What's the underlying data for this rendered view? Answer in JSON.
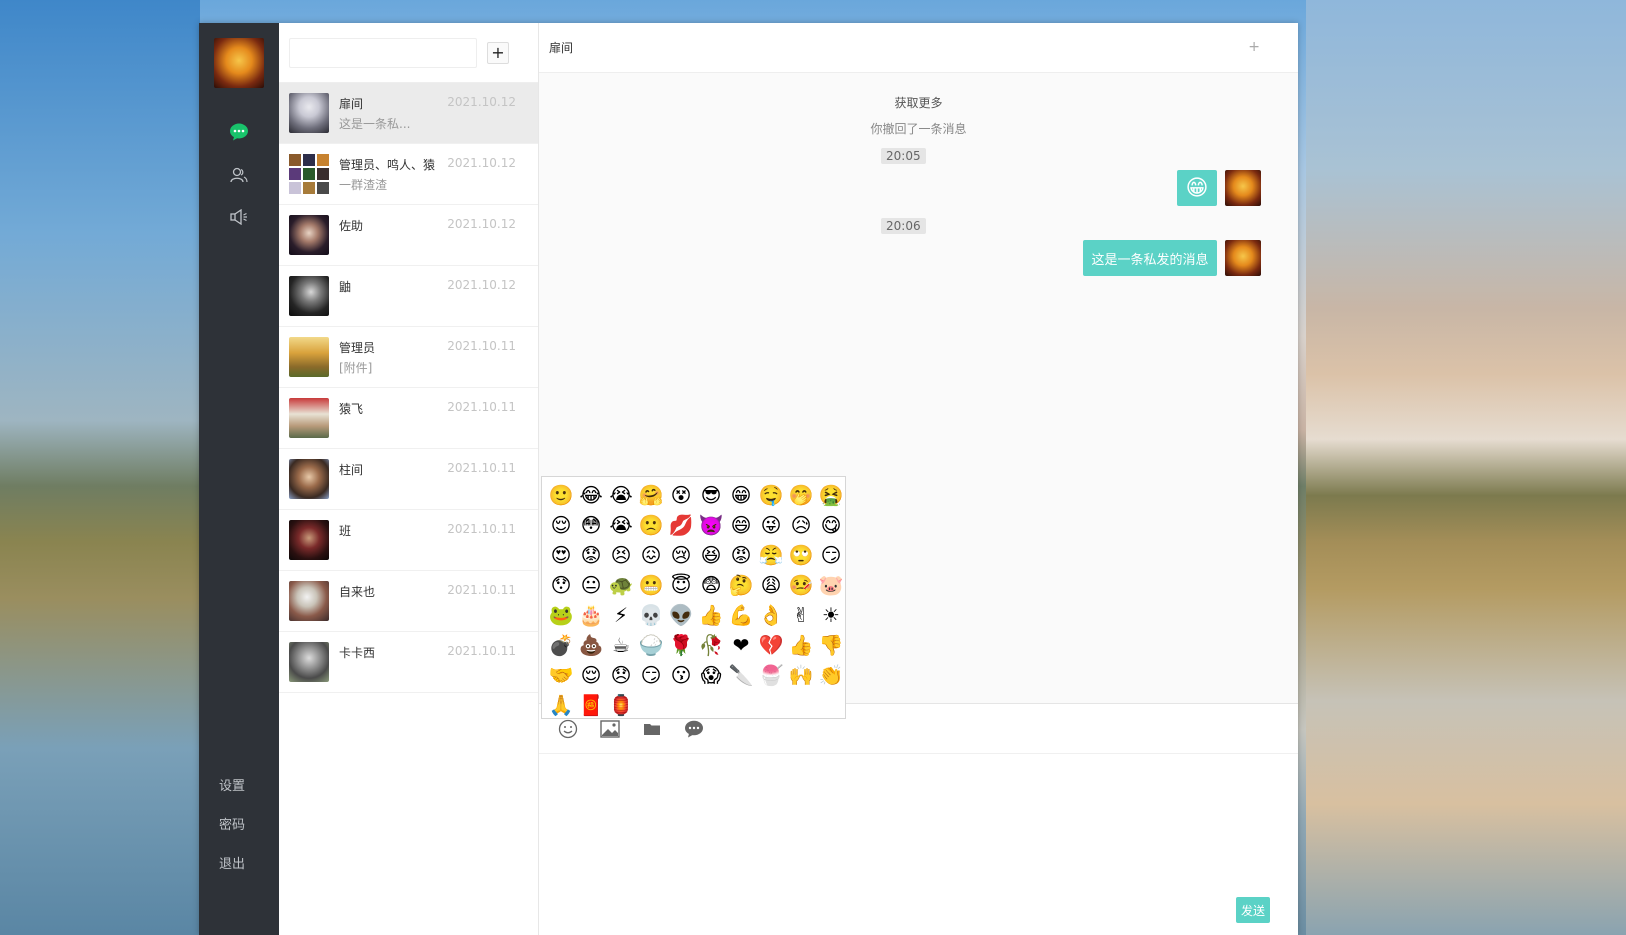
{
  "nav": {
    "settings_label": "设置",
    "password_label": "密码",
    "logout_label": "退出"
  },
  "search": {
    "placeholder": "",
    "value": ""
  },
  "conversations": [
    {
      "name": "扉间",
      "preview": "这是一条私...",
      "date": "2021.10.12"
    },
    {
      "name": "管理员、鸣人、猿",
      "preview": "一群渣渣",
      "date": "2021.10.12"
    },
    {
      "name": "佐助",
      "preview": "",
      "date": "2021.10.12"
    },
    {
      "name": "鼬",
      "preview": "",
      "date": "2021.10.12"
    },
    {
      "name": "管理员",
      "preview": "[附件]",
      "date": "2021.10.11"
    },
    {
      "name": "猿飞",
      "preview": "",
      "date": "2021.10.11"
    },
    {
      "name": "柱间",
      "preview": "",
      "date": "2021.10.11"
    },
    {
      "name": "班",
      "preview": "",
      "date": "2021.10.11"
    },
    {
      "name": "自来也",
      "preview": "",
      "date": "2021.10.11"
    },
    {
      "name": "卡卡西",
      "preview": "",
      "date": "2021.10.11"
    }
  ],
  "chat": {
    "title": "扉间",
    "more_icon": "+",
    "load_more": "获取更多",
    "recall_notice": "你撤回了一条消息",
    "time1": "20:05",
    "emoji_message": "😁",
    "time2": "20:06",
    "text_message": "这是一条私发的消息"
  },
  "emojis": [
    "🙂",
    "😂",
    "😭",
    "🤗",
    "😵",
    "😎",
    "😁",
    "🤤",
    "🤭",
    "🤮",
    "😌",
    "😳",
    "😭",
    "🙁",
    "💋",
    "👿",
    "😄",
    "😜",
    "😥",
    "😋",
    "😍",
    "😟",
    "😣",
    "😖",
    "😢",
    "😆",
    "😡",
    "😤",
    "🙄",
    "😏",
    "😯",
    "😐",
    "🐢",
    "😬",
    "😇",
    "😨",
    "🤔",
    "😩",
    "🤒",
    "🐷",
    "🐸",
    "🎂",
    "⚡",
    "💀",
    "👽",
    "👍",
    "💪",
    "👌",
    "✌",
    "☀",
    "💣",
    "💩",
    "☕",
    "🍚",
    "🌹",
    "🥀",
    "❤",
    "💔",
    "👍",
    "👎",
    "🤝",
    "😌",
    "😞",
    "😏",
    "😗",
    "😱",
    "🔪",
    "🍧",
    "🙌",
    "👏",
    "🙏",
    "🧧",
    "🏮"
  ],
  "composer": {
    "value": "",
    "send_label": "发送"
  }
}
